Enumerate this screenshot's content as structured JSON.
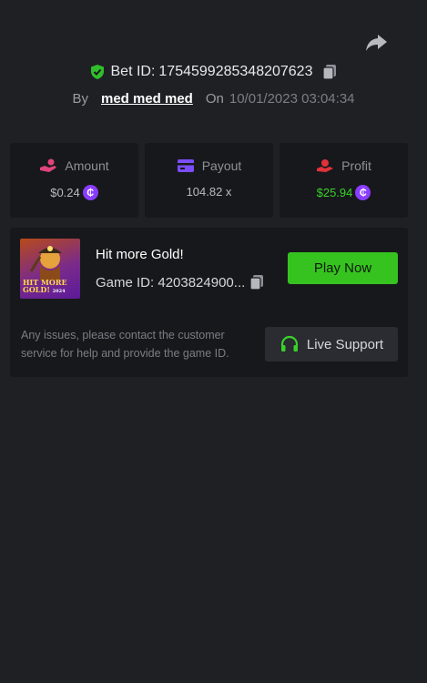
{
  "header": {
    "bet_label": "Bet ID:",
    "bet_id": "1754599285348207623",
    "by_label": "By",
    "username": "med med med",
    "on_label": "On",
    "date": "10/01/2023 03:04:34"
  },
  "stats": {
    "amount": {
      "label": "Amount",
      "value": "$0.24",
      "coin": "₵"
    },
    "payout": {
      "label": "Payout",
      "value": "104.82 x"
    },
    "profit": {
      "label": "Profit",
      "value": "$25.94",
      "coin": "₵"
    }
  },
  "game": {
    "thumbnail_text": "HIT MORE GOLD!",
    "thumbnail_sub": "2024",
    "title": "Hit more Gold!",
    "game_id": "Game ID: 4203824900...",
    "play_label": "Play Now"
  },
  "support": {
    "text": "Any issues, please contact the customer service for help and provide the game ID.",
    "button_label": "Live Support"
  },
  "colors": {
    "background": "#1f2024",
    "panel": "#17181b",
    "accent_green": "#36c31f",
    "profit_green": "#39d22a",
    "coin_purple": "#8a3dff"
  },
  "icons": {
    "share": "share-arrow-icon",
    "verified": "shield-check-icon",
    "copy": "copy-icon",
    "amount": "hand-coin-icon",
    "payout": "card-icon",
    "profit": "hand-money-icon",
    "support": "headset-icon"
  }
}
